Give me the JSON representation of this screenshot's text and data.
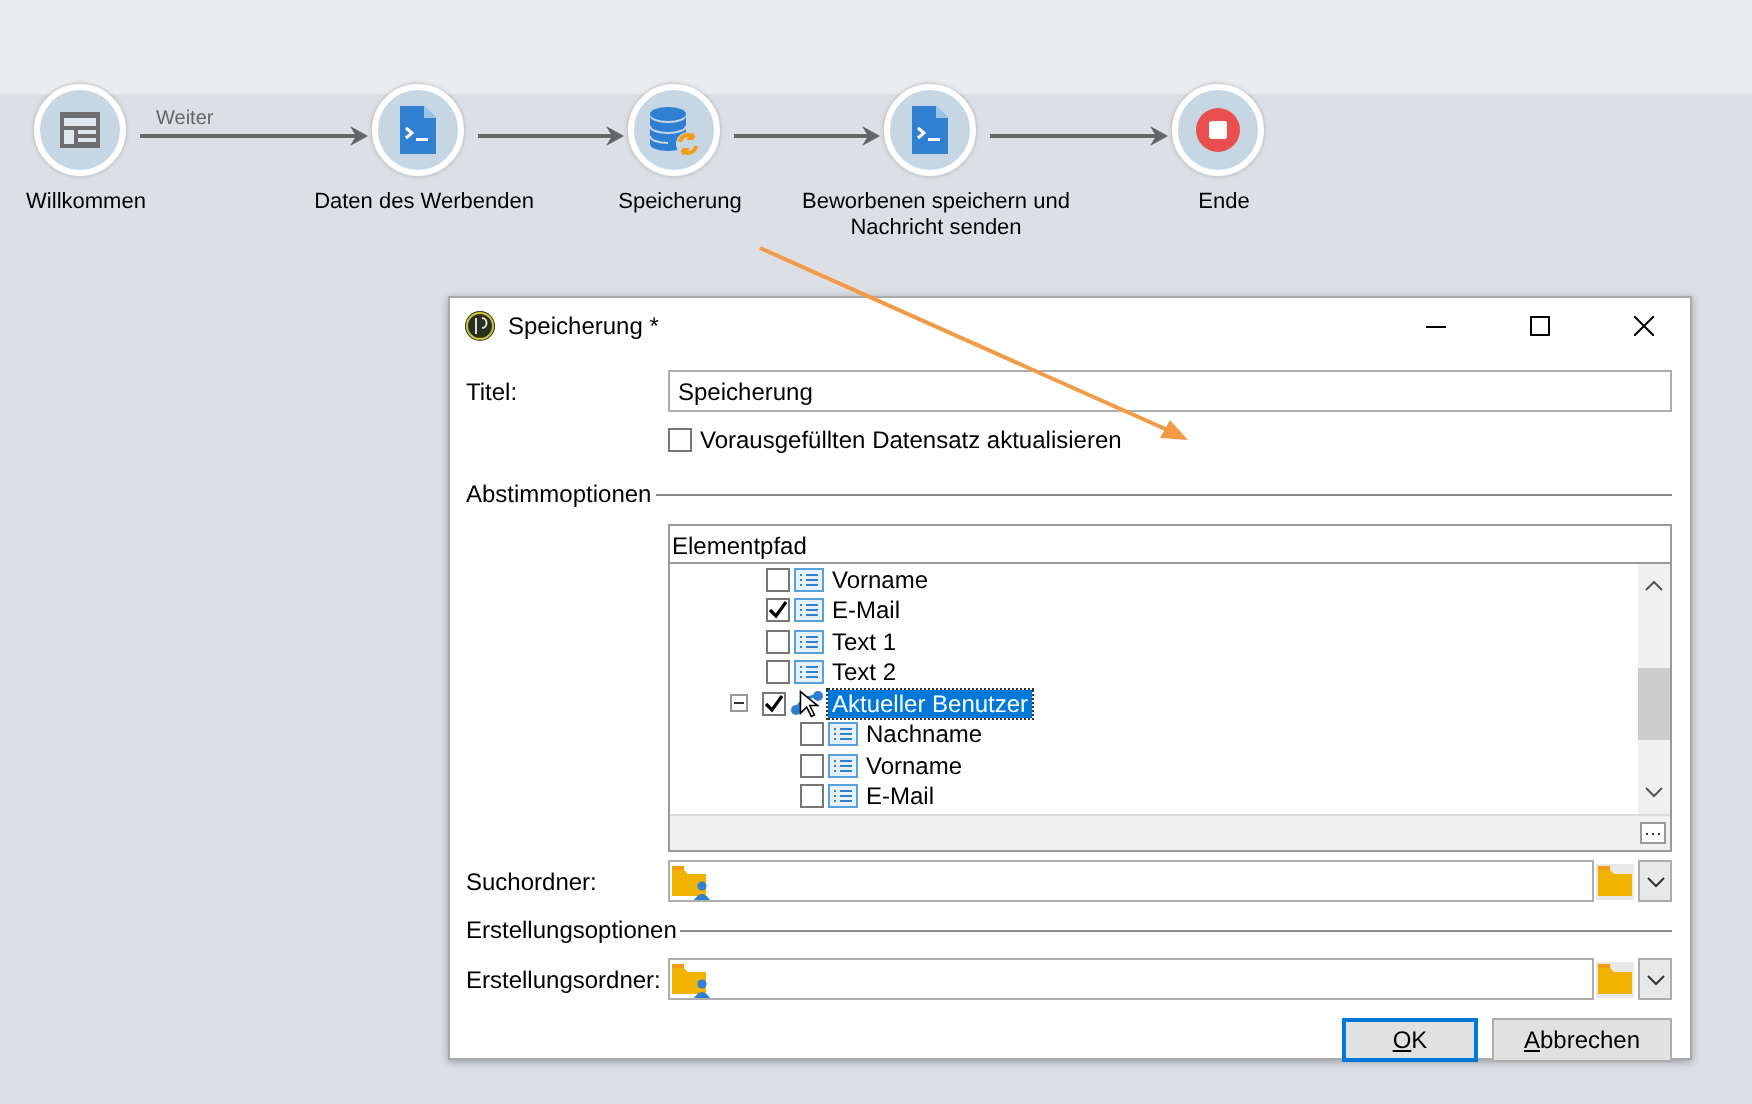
{
  "workflow": {
    "nodes": [
      {
        "label": "Willkommen",
        "kind": "form",
        "outgoing_label": "Weiter"
      },
      {
        "label": "Daten des Werbenden",
        "kind": "script"
      },
      {
        "label": "Speicherung",
        "kind": "storage"
      },
      {
        "label": "Beworbenen speichern und Nachricht senden",
        "kind": "script"
      },
      {
        "label": "Ende",
        "kind": "end"
      }
    ]
  },
  "dialog": {
    "title": "Speicherung *",
    "title_field": {
      "label": "Titel:",
      "value": "Speicherung"
    },
    "update_checkbox": {
      "label": "Vorausgefüllten Datensatz aktualisieren",
      "checked": false
    },
    "sections": [
      "Abstimmoptionen",
      "Erstellungsoptionen"
    ],
    "tree": {
      "column": "Elementpfad",
      "items": [
        {
          "label": "Vorname",
          "kind": "field",
          "checked": false,
          "selected": false
        },
        {
          "label": "E-Mail",
          "kind": "field",
          "checked": true,
          "selected": false
        },
        {
          "label": "Text 1",
          "kind": "field",
          "checked": false,
          "selected": false
        },
        {
          "label": "Text 2",
          "kind": "field",
          "checked": false,
          "selected": false
        },
        {
          "label": "Aktueller Benutzer",
          "kind": "link",
          "checked": true,
          "selected": true,
          "expanded": true,
          "children": [
            {
              "label": "Nachname",
              "kind": "field",
              "checked": false,
              "selected": false
            },
            {
              "label": "Vorname",
              "kind": "field",
              "checked": false,
              "selected": false
            },
            {
              "label": "E-Mail",
              "kind": "field",
              "checked": false,
              "selected": false
            }
          ]
        }
      ]
    },
    "search_folder": {
      "label": "Suchordner:"
    },
    "creation_folder": {
      "label": "Erstellungsordner:"
    },
    "buttons": [
      {
        "label": "OK",
        "default": true
      },
      {
        "label": "Abbrechen",
        "default": false
      }
    ]
  }
}
